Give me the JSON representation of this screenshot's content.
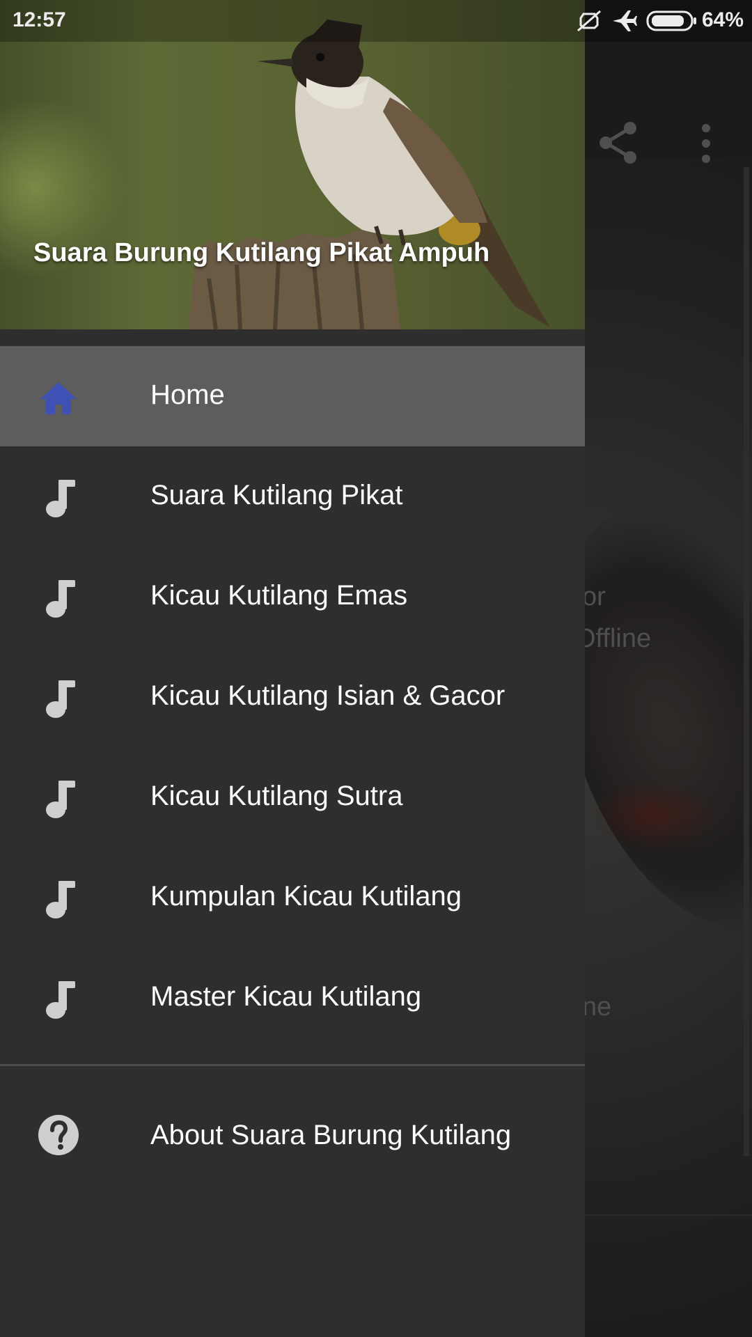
{
  "status_bar": {
    "time": "12:57",
    "battery": "64%",
    "icons": [
      "mute-icon",
      "airplane-icon",
      "battery-icon"
    ]
  },
  "drawer": {
    "title": "Suara Burung Kutilang Pikat Ampuh",
    "accent_color": "#3f51b5",
    "icon_color": "#cfcfcf",
    "items": [
      {
        "label": "Home",
        "icon": "home-icon",
        "active": true
      },
      {
        "label": "Suara Kutilang Pikat",
        "icon": "music-note-icon"
      },
      {
        "label": "Kicau Kutilang Emas",
        "icon": "music-note-icon"
      },
      {
        "label": "Kicau Kutilang Isian & Gacor",
        "icon": "music-note-icon"
      },
      {
        "label": "Kicau Kutilang Sutra",
        "icon": "music-note-icon"
      },
      {
        "label": "Kumpulan Kicau Kutilang",
        "icon": "music-note-icon"
      },
      {
        "label": "Master Kicau Kutilang",
        "icon": "music-note-icon"
      }
    ],
    "about": {
      "label": "About Suara Burung Kutilang",
      "icon": "help-circle-icon"
    }
  },
  "background": {
    "toolbar_icons": [
      "share-icon",
      "more-vert-icon"
    ],
    "text_fragments": [
      "or",
      "Offline",
      "ne"
    ]
  }
}
